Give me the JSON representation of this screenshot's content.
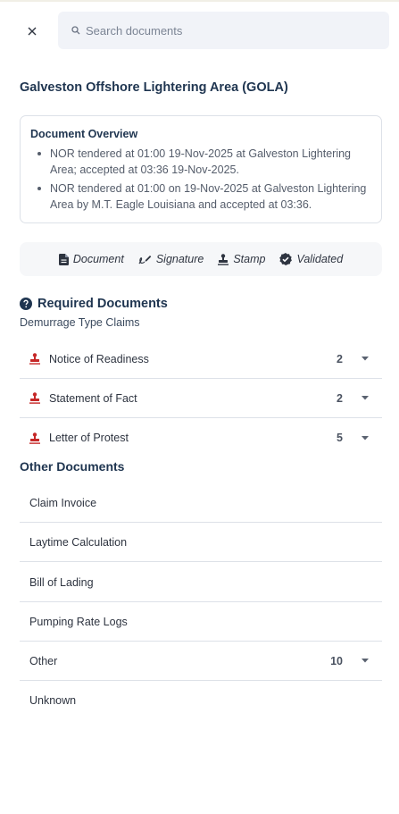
{
  "search": {
    "placeholder": "Search documents"
  },
  "title": "Galveston Offshore Lightering Area (GOLA)",
  "overview": {
    "heading": "Document Overview",
    "items": [
      "NOR tendered at 01:00 19-Nov-2025 at Galveston Lightering Area; accepted at 03:36 19-Nov-2025.",
      "NOR tendered at 01:00 on 19-Nov-2025 at Galveston Lightering Area by M.T. Eagle Louisiana and accepted at 03:36."
    ]
  },
  "legend": {
    "document": "Document",
    "signature": "Signature",
    "stamp": "Stamp",
    "validated": "Validated"
  },
  "required": {
    "heading": "Required Documents",
    "subheading": "Demurrage Type Claims",
    "items": [
      {
        "label": "Notice of Readiness",
        "count": "2"
      },
      {
        "label": "Statement of Fact",
        "count": "2"
      },
      {
        "label": "Letter of Protest",
        "count": "5"
      }
    ]
  },
  "other": {
    "heading": "Other Documents",
    "items": [
      {
        "label": "Claim Invoice",
        "count": ""
      },
      {
        "label": "Laytime Calculation",
        "count": ""
      },
      {
        "label": "Bill of Lading",
        "count": ""
      },
      {
        "label": "Pumping Rate Logs",
        "count": ""
      },
      {
        "label": "Other",
        "count": "10"
      },
      {
        "label": "Unknown",
        "count": ""
      }
    ]
  },
  "colors": {
    "stamp_red": "#c62828",
    "heading": "#1f3550",
    "search_bg": "#f1f3f8"
  }
}
